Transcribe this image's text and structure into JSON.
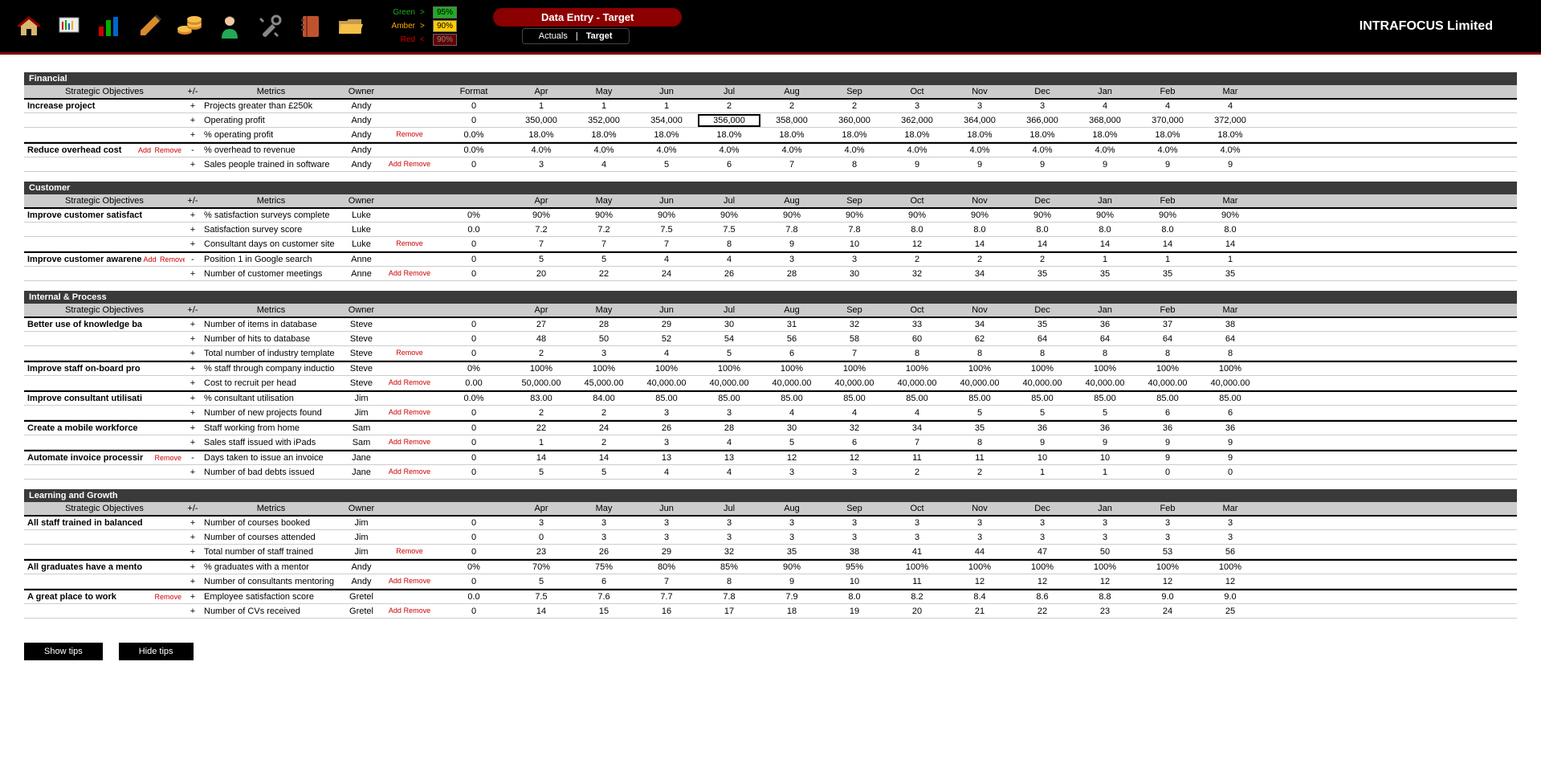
{
  "header": {
    "rag": {
      "green_label": "Green",
      "green_op": ">",
      "green_val": "95%",
      "amber_label": "Amber",
      "amber_op": ">",
      "amber_val": "90%",
      "red_label": "Red",
      "red_op": "<",
      "red_val": "90%"
    },
    "title": "Data Entry - Target",
    "tabs": {
      "actuals": "Actuals",
      "sep": "|",
      "target": "Target"
    },
    "company": "INTRAFOCUS Limited"
  },
  "labels": {
    "strategic_objectives": "Strategic Objectives",
    "pm": "+/-",
    "metrics": "Metrics",
    "owner": "Owner",
    "format": "Format",
    "add": "Add",
    "remove": "Remove",
    "show_tips": "Show tips",
    "hide_tips": "Hide tips"
  },
  "months": [
    "Apr",
    "May",
    "Jun",
    "Jul",
    "Aug",
    "Sep",
    "Oct",
    "Nov",
    "Dec",
    "Jan",
    "Feb",
    "Mar"
  ],
  "sections": [
    {
      "name": "Financial",
      "objectives": [
        {
          "name": "Increase project",
          "actions": [],
          "metrics": [
            {
              "pm": "+",
              "name": "Projects greater than £250k",
              "owner": "Andy",
              "actions": "",
              "fmt": "0",
              "vals": [
                "1",
                "1",
                "1",
                "2",
                "2",
                "2",
                "3",
                "3",
                "3",
                "4",
                "4",
                "4"
              ]
            },
            {
              "pm": "+",
              "name": "Operating profit",
              "owner": "Andy",
              "actions": "",
              "fmt": "0",
              "vals": [
                "350,000",
                "352,000",
                "354,000",
                "356,000",
                "358,000",
                "360,000",
                "362,000",
                "364,000",
                "366,000",
                "368,000",
                "370,000",
                "372,000"
              ],
              "selected": 3
            },
            {
              "pm": "+",
              "name": "% operating profit",
              "owner": "Andy",
              "actions": "Remove",
              "fmt": "0.0%",
              "vals": [
                "18.0%",
                "18.0%",
                "18.0%",
                "18.0%",
                "18.0%",
                "18.0%",
                "18.0%",
                "18.0%",
                "18.0%",
                "18.0%",
                "18.0%",
                "18.0%"
              ]
            }
          ]
        },
        {
          "name": "Reduce overhead cost",
          "actions": [
            "Add",
            "Remove"
          ],
          "metrics": [
            {
              "pm": "-",
              "name": "% overhead to revenue",
              "owner": "Andy",
              "actions": "",
              "fmt": "0.0%",
              "vals": [
                "4.0%",
                "4.0%",
                "4.0%",
                "4.0%",
                "4.0%",
                "4.0%",
                "4.0%",
                "4.0%",
                "4.0%",
                "4.0%",
                "4.0%",
                "4.0%"
              ]
            },
            {
              "pm": "+",
              "name": "Sales people trained in software",
              "owner": "Andy",
              "actions": "Add Remove",
              "fmt": "0",
              "vals": [
                "3",
                "4",
                "5",
                "6",
                "7",
                "8",
                "9",
                "9",
                "9",
                "9",
                "9",
                "9"
              ]
            }
          ]
        }
      ]
    },
    {
      "name": "Customer",
      "objectives": [
        {
          "name": "Improve customer satisfact",
          "actions": [],
          "metrics": [
            {
              "pm": "+",
              "name": "% satisfaction surveys complete",
              "owner": "Luke",
              "actions": "",
              "fmt": "0%",
              "vals": [
                "90%",
                "90%",
                "90%",
                "90%",
                "90%",
                "90%",
                "90%",
                "90%",
                "90%",
                "90%",
                "90%",
                "90%"
              ]
            },
            {
              "pm": "+",
              "name": "Satisfaction survey score",
              "owner": "Luke",
              "actions": "",
              "fmt": "0.0",
              "vals": [
                "7.2",
                "7.2",
                "7.5",
                "7.5",
                "7.8",
                "7.8",
                "8.0",
                "8.0",
                "8.0",
                "8.0",
                "8.0",
                "8.0"
              ]
            },
            {
              "pm": "+",
              "name": "Consultant days on customer site",
              "owner": "Luke",
              "actions": "Remove",
              "fmt": "0",
              "vals": [
                "7",
                "7",
                "7",
                "8",
                "9",
                "10",
                "12",
                "14",
                "14",
                "14",
                "14",
                "14"
              ]
            }
          ]
        },
        {
          "name": "Improve customer awarene",
          "actions": [
            "Add",
            "Remove"
          ],
          "metrics": [
            {
              "pm": "-",
              "name": "Position 1 in Google search",
              "owner": "Anne",
              "actions": "",
              "fmt": "0",
              "vals": [
                "5",
                "5",
                "4",
                "4",
                "3",
                "3",
                "2",
                "2",
                "2",
                "1",
                "1",
                "1"
              ]
            },
            {
              "pm": "+",
              "name": "Number of customer meetings",
              "owner": "Anne",
              "actions": "Add Remove",
              "fmt": "0",
              "vals": [
                "20",
                "22",
                "24",
                "26",
                "28",
                "30",
                "32",
                "34",
                "35",
                "35",
                "35",
                "35"
              ]
            }
          ]
        }
      ]
    },
    {
      "name": "Internal & Process",
      "objectives": [
        {
          "name": "Better use of knowledge ba",
          "actions": [],
          "metrics": [
            {
              "pm": "+",
              "name": "Number of items in database",
              "owner": "Steve",
              "actions": "",
              "fmt": "0",
              "vals": [
                "27",
                "28",
                "29",
                "30",
                "31",
                "32",
                "33",
                "34",
                "35",
                "36",
                "37",
                "38"
              ]
            },
            {
              "pm": "+",
              "name": "Number of hits to database",
              "owner": "Steve",
              "actions": "",
              "fmt": "0",
              "vals": [
                "48",
                "50",
                "52",
                "54",
                "56",
                "58",
                "60",
                "62",
                "64",
                "64",
                "64",
                "64"
              ]
            },
            {
              "pm": "+",
              "name": "Total number of industry template",
              "owner": "Steve",
              "actions": "Remove",
              "fmt": "0",
              "vals": [
                "2",
                "3",
                "4",
                "5",
                "6",
                "7",
                "8",
                "8",
                "8",
                "8",
                "8",
                "8"
              ]
            }
          ]
        },
        {
          "name": "Improve staff on-board pro",
          "actions": [],
          "metrics": [
            {
              "pm": "+",
              "name": "% staff through company inductio",
              "owner": "Steve",
              "actions": "",
              "fmt": "0%",
              "vals": [
                "100%",
                "100%",
                "100%",
                "100%",
                "100%",
                "100%",
                "100%",
                "100%",
                "100%",
                "100%",
                "100%",
                "100%"
              ]
            },
            {
              "pm": "+",
              "name": "Cost to recruit per head",
              "owner": "Steve",
              "actions": "Add Remove",
              "fmt": "0.00",
              "vals": [
                "50,000.00",
                "45,000.00",
                "40,000.00",
                "40,000.00",
                "40,000.00",
                "40,000.00",
                "40,000.00",
                "40,000.00",
                "40,000.00",
                "40,000.00",
                "40,000.00",
                "40,000.00"
              ]
            }
          ]
        },
        {
          "name": "Improve consultant utilisati",
          "actions": [],
          "metrics": [
            {
              "pm": "+",
              "name": "% consultant utilisation",
              "owner": "Jim",
              "actions": "",
              "fmt": "0.0%",
              "vals": [
                "83.00",
                "84.00",
                "85.00",
                "85.00",
                "85.00",
                "85.00",
                "85.00",
                "85.00",
                "85.00",
                "85.00",
                "85.00",
                "85.00"
              ]
            },
            {
              "pm": "+",
              "name": "Number of new projects found",
              "owner": "Jim",
              "actions": "Add Remove",
              "fmt": "0",
              "vals": [
                "2",
                "2",
                "3",
                "3",
                "4",
                "4",
                "4",
                "5",
                "5",
                "5",
                "6",
                "6"
              ]
            }
          ]
        },
        {
          "name": "Create a mobile workforce",
          "actions": [],
          "metrics": [
            {
              "pm": "+",
              "name": "Staff working from home",
              "owner": "Sam",
              "actions": "",
              "fmt": "0",
              "vals": [
                "22",
                "24",
                "26",
                "28",
                "30",
                "32",
                "34",
                "35",
                "36",
                "36",
                "36",
                "36"
              ]
            },
            {
              "pm": "+",
              "name": "Sales staff issued with iPads",
              "owner": "Sam",
              "actions": "Add Remove",
              "fmt": "0",
              "vals": [
                "1",
                "2",
                "3",
                "4",
                "5",
                "6",
                "7",
                "8",
                "9",
                "9",
                "9",
                "9"
              ]
            }
          ]
        },
        {
          "name": "Automate invoice processir",
          "actions": [
            "Remove"
          ],
          "metrics": [
            {
              "pm": "-",
              "name": "Days taken to issue an invoice",
              "owner": "Jane",
              "actions": "",
              "fmt": "0",
              "vals": [
                "14",
                "14",
                "13",
                "13",
                "12",
                "12",
                "11",
                "11",
                "10",
                "10",
                "9",
                "9"
              ]
            },
            {
              "pm": "+",
              "name": "Number of bad debts issued",
              "owner": "Jane",
              "actions": "Add Remove",
              "fmt": "0",
              "vals": [
                "5",
                "5",
                "4",
                "4",
                "3",
                "3",
                "2",
                "2",
                "1",
                "1",
                "0",
                "0"
              ]
            }
          ]
        }
      ]
    },
    {
      "name": "Learning and Growth",
      "objectives": [
        {
          "name": "All staff trained in balanced",
          "actions": [],
          "metrics": [
            {
              "pm": "+",
              "name": "Number of courses booked",
              "owner": "Jim",
              "actions": "",
              "fmt": "0",
              "vals": [
                "3",
                "3",
                "3",
                "3",
                "3",
                "3",
                "3",
                "3",
                "3",
                "3",
                "3",
                "3"
              ]
            },
            {
              "pm": "+",
              "name": "Number of courses attended",
              "owner": "Jim",
              "actions": "",
              "fmt": "0",
              "vals": [
                "0",
                "3",
                "3",
                "3",
                "3",
                "3",
                "3",
                "3",
                "3",
                "3",
                "3",
                "3"
              ]
            },
            {
              "pm": "+",
              "name": "Total number of staff trained",
              "owner": "Jim",
              "actions": "Remove",
              "fmt": "0",
              "vals": [
                "23",
                "26",
                "29",
                "32",
                "35",
                "38",
                "41",
                "44",
                "47",
                "50",
                "53",
                "56"
              ]
            }
          ]
        },
        {
          "name": "All graduates have a mento",
          "actions": [],
          "metrics": [
            {
              "pm": "+",
              "name": "% graduates with a mentor",
              "owner": "Andy",
              "actions": "",
              "fmt": "0%",
              "vals": [
                "70%",
                "75%",
                "80%",
                "85%",
                "90%",
                "95%",
                "100%",
                "100%",
                "100%",
                "100%",
                "100%",
                "100%"
              ]
            },
            {
              "pm": "+",
              "name": "Number of consultants mentoring",
              "owner": "Andy",
              "actions": "Add Remove",
              "fmt": "0",
              "vals": [
                "5",
                "6",
                "7",
                "8",
                "9",
                "10",
                "11",
                "12",
                "12",
                "12",
                "12",
                "12"
              ]
            }
          ]
        },
        {
          "name": "A great place to work",
          "actions": [
            "Remove"
          ],
          "metrics": [
            {
              "pm": "+",
              "name": "Employee satisfaction score",
              "owner": "Gretel",
              "actions": "",
              "fmt": "0.0",
              "vals": [
                "7.5",
                "7.6",
                "7.7",
                "7.8",
                "7.9",
                "8.0",
                "8.2",
                "8.4",
                "8.6",
                "8.8",
                "9.0",
                "9.0"
              ]
            },
            {
              "pm": "+",
              "name": "Number of CVs received",
              "owner": "Gretel",
              "actions": "Add Remove",
              "fmt": "0",
              "vals": [
                "14",
                "15",
                "16",
                "17",
                "18",
                "19",
                "20",
                "21",
                "22",
                "23",
                "24",
                "25"
              ]
            }
          ]
        }
      ]
    }
  ]
}
